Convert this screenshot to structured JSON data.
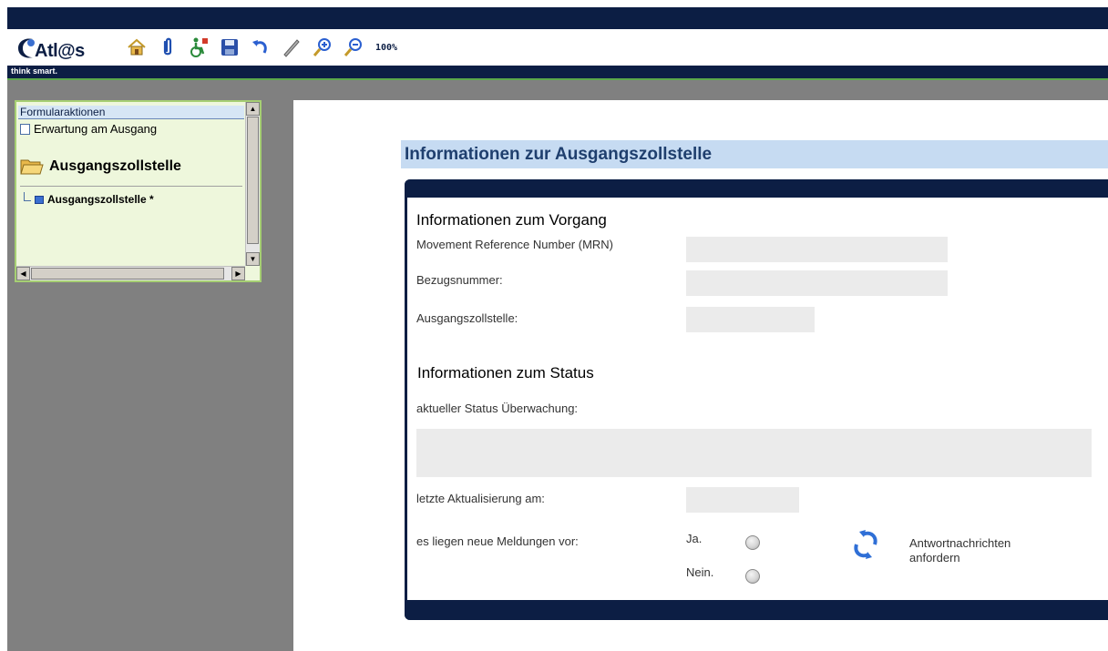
{
  "app": {
    "logo_text": "Atl@s",
    "tagline": "think smart.",
    "zoom_label": "100%"
  },
  "toolbar": {
    "icons": [
      "home-icon",
      "paperclip-icon",
      "accessibility-icon",
      "save-icon",
      "undo-icon",
      "pen-icon",
      "zoom-in-icon",
      "zoom-out-icon"
    ]
  },
  "sidebar": {
    "header": "Formularaktionen",
    "action": "Erwartung am Ausgang",
    "section_title": "Ausgangszollstelle",
    "tree_item": "Ausgangszollstelle *"
  },
  "form": {
    "title": "Informationen zur Ausgangszollstelle",
    "section1_heading": "Informationen zum Vorgang",
    "mrn_label": "Movement Reference Number (MRN)",
    "mrn_value": "",
    "ref_label": "Bezugsnummer:",
    "ref_value": "",
    "office_label": "Ausgangszollstelle:",
    "office_value": "",
    "section2_heading": "Informationen zum Status",
    "status_label": "aktueller Status Überwachung:",
    "status_value": "",
    "updated_label": "letzte Aktualisierung am:",
    "updated_value": "",
    "messages_label": "es liegen neue Meldungen vor:",
    "yes_label": "Ja.",
    "no_label": "Nein.",
    "request_line1": "Antwortnachrichten",
    "request_line2": "anfordern"
  },
  "colors": {
    "navy": "#0c1e44",
    "title_bar": "#c6dbf2",
    "panel_bg": "#eef7dc",
    "panel_border": "#a6cf73"
  }
}
